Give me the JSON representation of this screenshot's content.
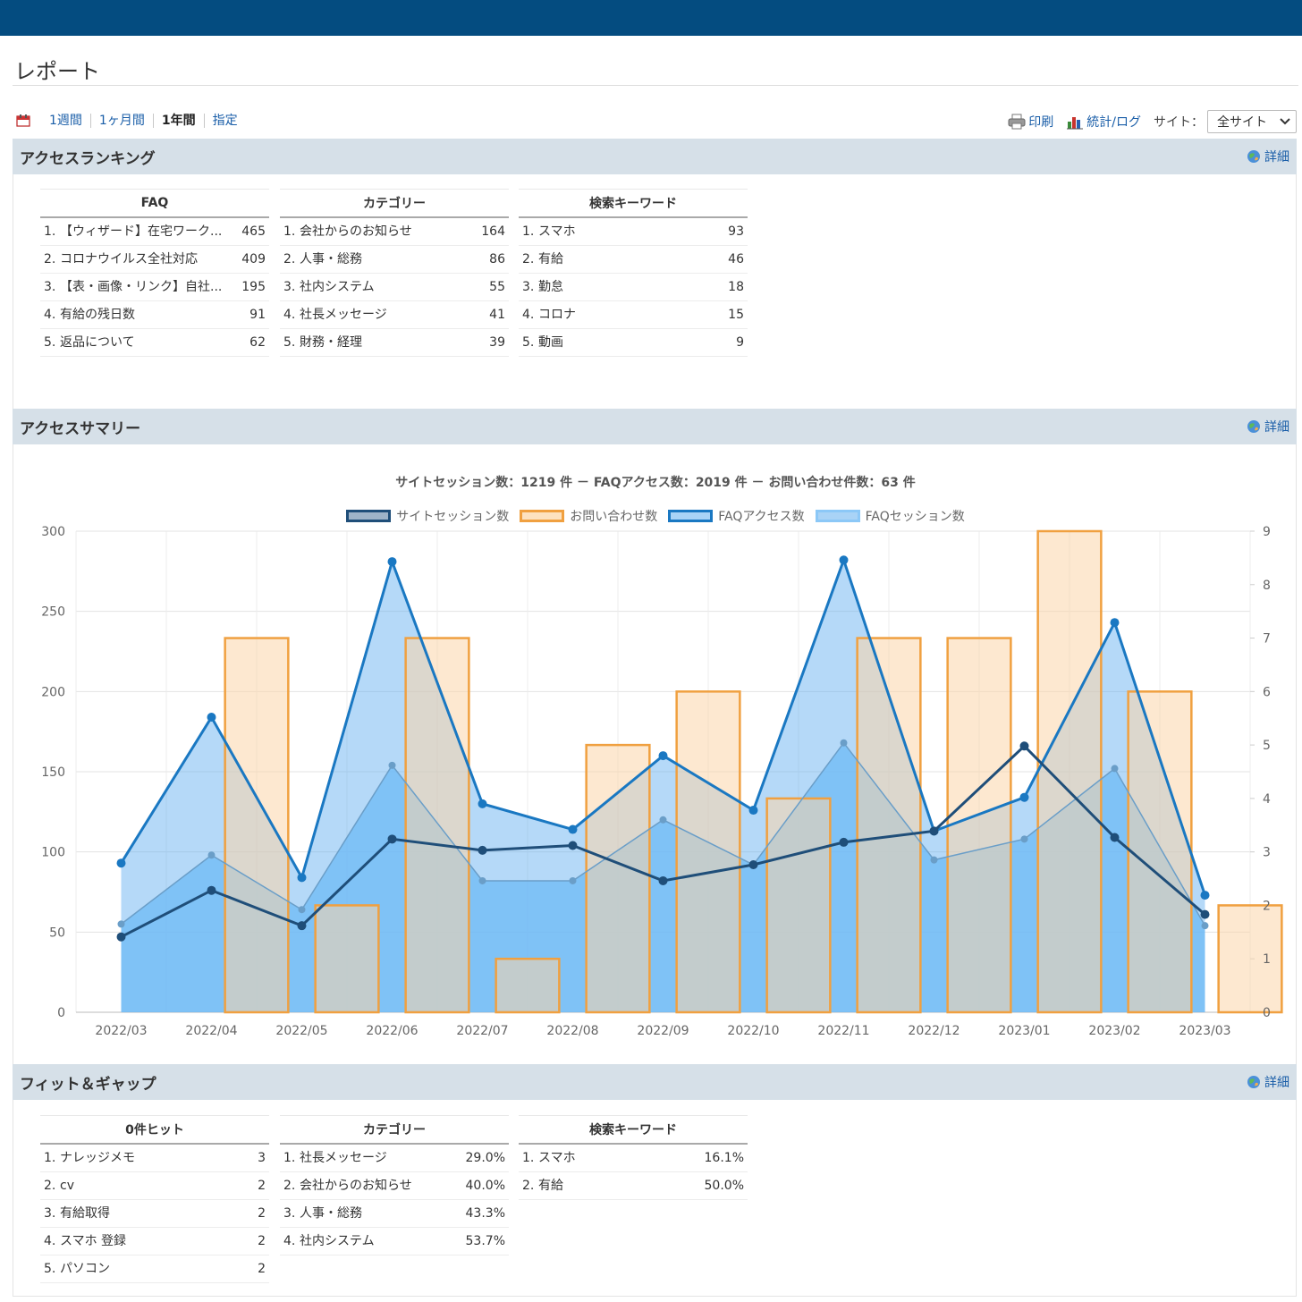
{
  "page": {
    "title": "レポート"
  },
  "toolbar": {
    "periods": [
      "1週間",
      "1ヶ月間",
      "1年間",
      "指定"
    ],
    "active_period": "1年間",
    "print_label": "印刷",
    "stats_label": "統計/ログ",
    "site_label": "サイト：",
    "site_value": "全サイト"
  },
  "ranking": {
    "title": "アクセスランキング",
    "detail_label": "詳細",
    "faq": {
      "header": "FAQ",
      "rows": [
        {
          "num": "1.",
          "label": "【ウィザード】在宅ワーク...",
          "value": "465"
        },
        {
          "num": "2.",
          "label": "コロナウイルス全社対応",
          "value": "409"
        },
        {
          "num": "3.",
          "label": "【表・画像・リンク】自社...",
          "value": "195"
        },
        {
          "num": "4.",
          "label": "有給の残日数",
          "value": "91"
        },
        {
          "num": "5.",
          "label": "返品について",
          "value": "62"
        }
      ]
    },
    "category": {
      "header": "カテゴリー",
      "rows": [
        {
          "num": "1.",
          "label": "会社からのお知らせ",
          "value": "164"
        },
        {
          "num": "2.",
          "label": "人事・総務",
          "value": "86"
        },
        {
          "num": "3.",
          "label": "社内システム",
          "value": "55"
        },
        {
          "num": "4.",
          "label": "社長メッセージ",
          "value": "41"
        },
        {
          "num": "5.",
          "label": "財務・経理",
          "value": "39"
        }
      ]
    },
    "keyword": {
      "header": "検索キーワード",
      "rows": [
        {
          "num": "1.",
          "label": "スマホ",
          "value": "93"
        },
        {
          "num": "2.",
          "label": "有給",
          "value": "46"
        },
        {
          "num": "3.",
          "label": "勤怠",
          "value": "18"
        },
        {
          "num": "4.",
          "label": "コロナ",
          "value": "15"
        },
        {
          "num": "5.",
          "label": "動画",
          "value": "9"
        }
      ]
    }
  },
  "summary": {
    "title": "アクセスサマリー",
    "detail_label": "詳細",
    "caption": "サイトセッション数：1219 件 － FAQアクセス数：2019 件 － お問い合わせ件数：63 件"
  },
  "fitgap": {
    "title": "フィット＆ギャップ",
    "detail_label": "詳細",
    "zero_hit": {
      "header": "0件ヒット",
      "rows": [
        {
          "num": "1.",
          "label": "ナレッジメモ",
          "value": "3"
        },
        {
          "num": "2.",
          "label": "cv",
          "value": "2"
        },
        {
          "num": "3.",
          "label": "有給取得",
          "value": "2"
        },
        {
          "num": "4.",
          "label": "スマホ 登録",
          "value": "2"
        },
        {
          "num": "5.",
          "label": "パソコン",
          "value": "2"
        }
      ]
    },
    "category": {
      "header": "カテゴリー",
      "rows": [
        {
          "num": "1.",
          "label": "社長メッセージ",
          "value": "29.0%"
        },
        {
          "num": "2.",
          "label": "会社からのお知らせ",
          "value": "40.0%"
        },
        {
          "num": "3.",
          "label": "人事・総務",
          "value": "43.3%"
        },
        {
          "num": "4.",
          "label": "社内システム",
          "value": "53.7%"
        }
      ]
    },
    "keyword": {
      "header": "検索キーワード",
      "rows": [
        {
          "num": "1.",
          "label": "スマホ",
          "value": "16.1%"
        },
        {
          "num": "2.",
          "label": "有給",
          "value": "50.0%"
        }
      ]
    }
  },
  "chart_data": {
    "type": "bar",
    "categories": [
      "2022/03",
      "2022/04",
      "2022/05",
      "2022/06",
      "2022/07",
      "2022/08",
      "2022/09",
      "2022/10",
      "2022/11",
      "2022/12",
      "2023/01",
      "2023/02",
      "2023/03"
    ],
    "ylim": [
      0,
      300
    ],
    "y2lim": [
      0,
      9
    ],
    "yticks": [
      "0",
      "50",
      "100",
      "150",
      "200",
      "250",
      "300"
    ],
    "y2ticks": [
      "0",
      "1",
      "2",
      "3",
      "4",
      "5",
      "6",
      "7",
      "8",
      "9"
    ],
    "grid": true,
    "legend_position": "top-center",
    "series": [
      {
        "name": "サイトセッション数",
        "type": "line",
        "axis": "left",
        "color": "#1f4e79",
        "values": [
          47,
          76,
          54,
          108,
          101,
          104,
          82,
          92,
          106,
          113,
          166,
          109,
          61
        ]
      },
      {
        "name": "お問い合わせ数",
        "type": "bar",
        "axis": "right",
        "color": "#f0a040",
        "values": [
          0,
          7,
          2,
          7,
          1,
          5,
          6,
          4,
          7,
          7,
          9,
          6,
          2
        ]
      },
      {
        "name": "FAQアクセス数",
        "type": "area",
        "axis": "left",
        "color": "#1a78c2",
        "values": [
          93,
          184,
          84,
          281,
          130,
          114,
          160,
          126,
          282,
          113,
          134,
          243,
          73
        ]
      },
      {
        "name": "FAQセッション数",
        "type": "area",
        "axis": "left",
        "color": "#8cc8f7",
        "values": [
          55,
          98,
          64,
          154,
          82,
          82,
          120,
          92,
          168,
          95,
          108,
          152,
          54
        ]
      }
    ]
  }
}
